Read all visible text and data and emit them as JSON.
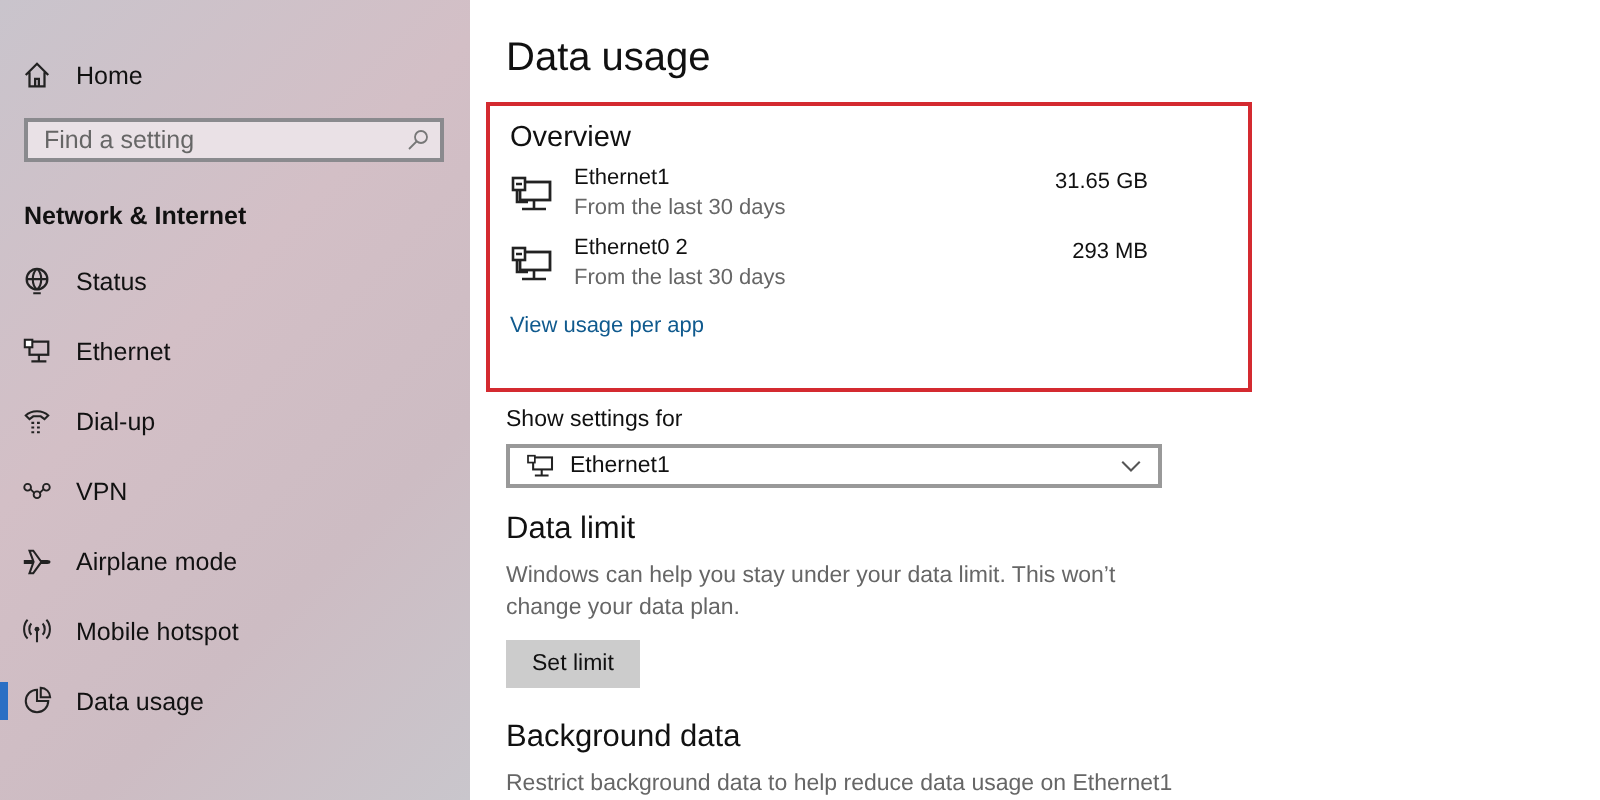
{
  "sidebar": {
    "home": {
      "label": "Home"
    },
    "search": {
      "placeholder": "Find a setting"
    },
    "section_title": "Network & Internet",
    "items": [
      {
        "label": "Status",
        "selected": false
      },
      {
        "label": "Ethernet",
        "selected": false
      },
      {
        "label": "Dial-up",
        "selected": false
      },
      {
        "label": "VPN",
        "selected": false
      },
      {
        "label": "Airplane mode",
        "selected": false
      },
      {
        "label": "Mobile hotspot",
        "selected": false
      },
      {
        "label": "Data usage",
        "selected": true
      }
    ]
  },
  "main": {
    "title": "Data usage",
    "overview": {
      "title": "Overview",
      "highlighted": true,
      "networks": [
        {
          "name": "Ethernet1",
          "period": "From the last 30 days",
          "usage": "31.65 GB"
        },
        {
          "name": "Ethernet0 2",
          "period": "From the last 30 days",
          "usage": "293 MB"
        }
      ],
      "link": "View usage per app"
    },
    "show_settings": {
      "label": "Show settings for",
      "value": "Ethernet1"
    },
    "data_limit": {
      "title": "Data limit",
      "description": "Windows can help you stay under your data limit. This won’t change your data plan.",
      "button": "Set limit"
    },
    "background_data": {
      "title": "Background data",
      "description": "Restrict background data to help reduce data usage on Ethernet1"
    }
  }
}
